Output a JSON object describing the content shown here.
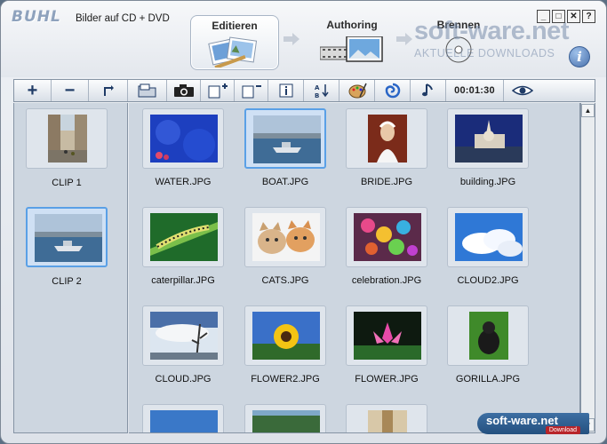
{
  "header": {
    "logo": "BUHL",
    "title": "Bilder auf CD + DVD",
    "steps": {
      "edit": "Editieren",
      "authoring": "Authoring",
      "burn": "Brennen"
    },
    "window_buttons": [
      "_",
      "□",
      "✕",
      "?"
    ],
    "info": "i"
  },
  "watermark": {
    "brand": "soft-ware.net",
    "subtitle": "AKTUELLE DOWNLOADS",
    "badge": "soft-ware.net",
    "badge_sub": "Download"
  },
  "toolbar": {
    "add": "+",
    "remove": "−",
    "time": "00:01:30"
  },
  "clips": [
    {
      "label": "CLIP 1",
      "image": "street",
      "selected": false
    },
    {
      "label": "CLIP 2",
      "image": "boat",
      "selected": true
    }
  ],
  "images": [
    {
      "label": "WATER.JPG",
      "image": "water",
      "selected": false
    },
    {
      "label": "BOAT.JPG",
      "image": "boat",
      "selected": true
    },
    {
      "label": "BRIDE.JPG",
      "image": "bride",
      "selected": false
    },
    {
      "label": "building.JPG",
      "image": "building",
      "selected": false
    },
    {
      "label": "caterpillar.JPG",
      "image": "caterpillar",
      "selected": false
    },
    {
      "label": "CATS.JPG",
      "image": "cats",
      "selected": false
    },
    {
      "label": "celebration.JPG",
      "image": "celebration",
      "selected": false
    },
    {
      "label": "CLOUD2.JPG",
      "image": "cloud2",
      "selected": false
    },
    {
      "label": "CLOUD.JPG",
      "image": "cloud",
      "selected": false
    },
    {
      "label": "FLOWER2.JPG",
      "image": "flower2",
      "selected": false
    },
    {
      "label": "FLOWER.JPG",
      "image": "flower",
      "selected": false
    },
    {
      "label": "GORILLA.JPG",
      "image": "gorilla",
      "selected": false
    }
  ],
  "colors": {
    "accent": "#5aa0e6",
    "panel": "#cdd6e0",
    "toolbar_icon": "#1f3b66"
  }
}
